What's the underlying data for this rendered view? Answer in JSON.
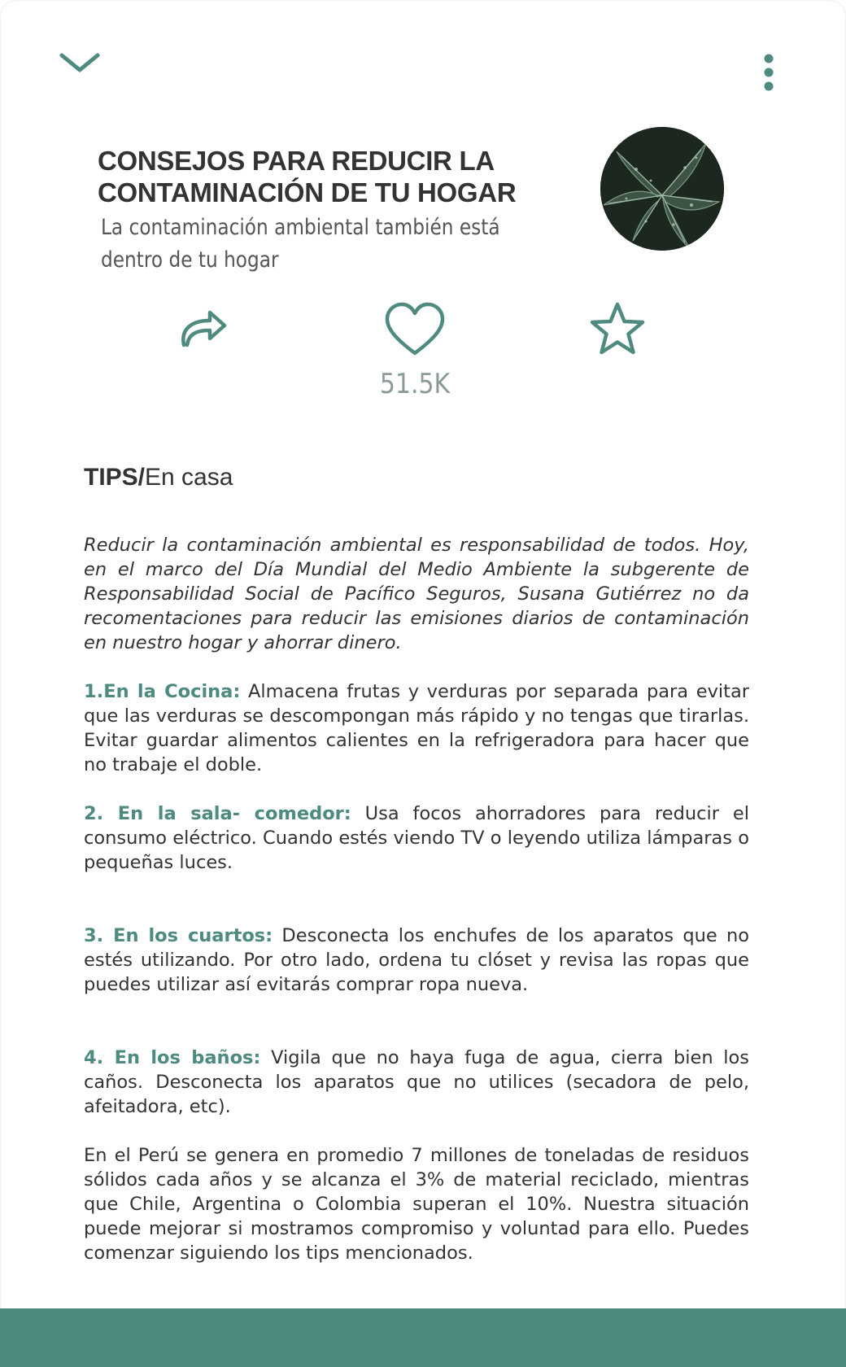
{
  "article": {
    "title_line1": "CONSEJOS PARA REDUCIR LA",
    "title_line2": "CONTAMINACIÓN DE TU HOGAR",
    "subtitle": "La contaminación ambiental también está dentro de tu hogar",
    "likes": "51.5K",
    "section_bold": "TIPS/",
    "section_rest": "En casa",
    "intro": "Reducir la contaminación ambiental es responsabilidad de todos. Hoy, en el marco del Día Mundial del Medio Ambiente la subgerente de Responsabilidad Social de Pacífico Seguros, Susana Gutiérrez no da recomentaciones para reducir las emisiones diarios de contaminación en nuestro hogar y ahorrar dinero.",
    "tips": [
      {
        "label": "1.En la Cocina:",
        "text": " Almacena frutas y verduras por separada para evitar que las verduras se descompongan más rápido y no tengas que tirarlas. Evitar guardar alimentos calientes en la refrigeradora para hacer que no trabaje el doble."
      },
      {
        "label": "2. En la sala- comedor:",
        "text": " Usa focos ahorradores para reducir el consumo eléctrico. Cuando estés viendo TV o leyendo utiliza lámparas o pequeñas luces."
      },
      {
        "label": "3. En los cuartos:",
        "text": " Desconecta los enchufes de los aparatos que no estés utilizando. Por otro lado, ordena tu clóset y revisa las ropas que puedes utilizar así evitarás comprar ropa nueva."
      },
      {
        "label": "4. En los baños:",
        "text": " Vigila que no haya fuga de agua, cierra bien los caños. Desconecta los aparatos que no utilices (secadora de pelo, afeitadora, etc)."
      }
    ],
    "closing": "En el Perú se genera en promedio 7 millones de toneladas de residuos sólidos cada años y se alcanza el 3% de material reciclado, mientras que Chile, Argentina o Colombia superan el 10%. Nuestra situación puede mejorar si mostramos compromiso y voluntad para ello. Puedes comenzar siguiendo los tips mencionados."
  },
  "icons": {
    "collapse": "chevron-down-icon",
    "more": "more-vertical-icon",
    "share": "share-icon",
    "like": "heart-icon",
    "favorite": "star-icon"
  },
  "colors": {
    "accent": "#4e8a7f",
    "tip_label": "#4d8a80",
    "likes_text": "#8a9a98"
  }
}
